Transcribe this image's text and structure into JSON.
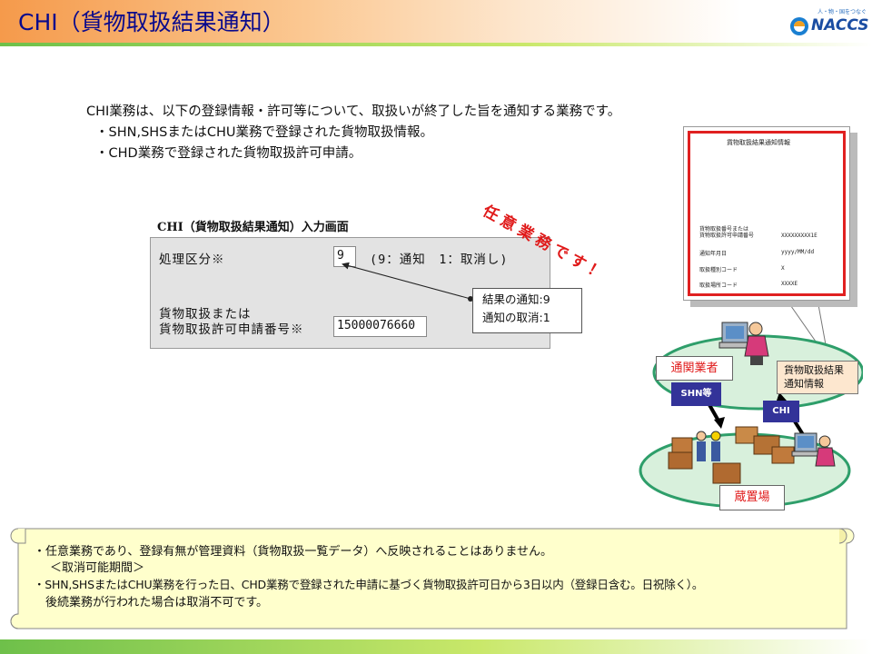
{
  "header": {
    "title": "CHI（貨物取扱結果通知）",
    "logo_text": "NACCS",
    "logo_tagline": "人・物・国をつなぐ"
  },
  "intro": {
    "line1": "CHI業務は、以下の登録情報・許可等について、取扱いが終了した旨を通知する業務です。",
    "line2": "・SHN,SHSまたはCHU業務で登録された貨物取扱情報。",
    "line3": "・CHD業務で登録された貨物取扱許可申請。"
  },
  "input_screen": {
    "label": "CHI（貨物取扱結果通知）入力画面",
    "row1_label": "処理区分※",
    "row1_value": "9",
    "row1_hint": "(9：通知　1：取消し)",
    "row2_label_line1": "貨物取扱または",
    "row2_label_line2": "貨物取扱許可申請番号※",
    "row2_value": "15000076660",
    "callout_line1": "結果の通知:9",
    "callout_line2": "通知の取消:1"
  },
  "optional_badge": "任意業務です！",
  "notification_document": {
    "title": "貨物取扱結果通知情報",
    "rows": [
      {
        "label": "貨物取扱番号または\n貨物取扱許可申請番号",
        "value": "XXXXXXXXX1E"
      },
      {
        "label": "通知年月日",
        "value": "yyyy/MM/dd"
      },
      {
        "label": "取扱種別コード",
        "value": "X"
      },
      {
        "label": "取扱場所コード",
        "value": "XXXXE"
      }
    ]
  },
  "diagram": {
    "customs_broker": "通関業者",
    "shn_label": "SHN等",
    "chi_label": "CHI",
    "notice_line1": "貨物取扱結果",
    "notice_line2": "通知情報",
    "warehouse": "蔵置場"
  },
  "notes": {
    "line1": "・任意業務であり、登録有無が管理資料（貨物取扱一覧データ）へ反映されることはありません。",
    "line2": "＜取消可能期間＞",
    "line3": "・SHN,SHSまたはCHU業務を行った日、CHD業務で登録された申請に基づく貨物取扱許可日から3日以内（登録日含む。日祝除く）。",
    "line4": "後続業務が行われた場合は取消不可です。"
  },
  "colors": {
    "title": "#0a0a8c",
    "accent_red": "#e01a1a",
    "label_blue": "#333399",
    "ellipse_green": "#2e9e6a",
    "scroll_fill": "#ffffcc"
  }
}
